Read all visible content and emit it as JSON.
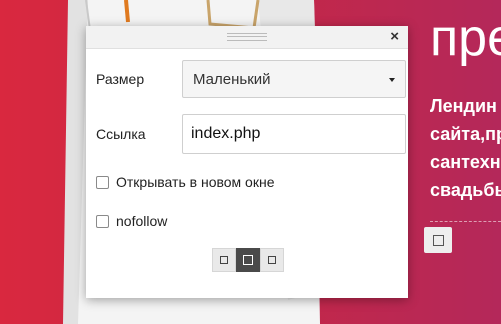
{
  "hero": {
    "heading": "пре",
    "lines": [
      "Лендин",
      "сайта,пр",
      "сантехн",
      "свадьбы"
    ]
  },
  "dialog": {
    "close_glyph": "×",
    "size_label": "Размер",
    "size_value": "Маленький",
    "link_label": "Ссылка",
    "link_value": "index.php",
    "new_window_label": "Открывать в новом окне",
    "nofollow_label": "nofollow",
    "align_options": [
      "align-left",
      "align-center",
      "align-right"
    ],
    "align_selected": "align-center"
  },
  "colors": {
    "bg_left": "#d9283f",
    "bg_right": "#b4285a",
    "active_button": "#4a4a4a"
  }
}
